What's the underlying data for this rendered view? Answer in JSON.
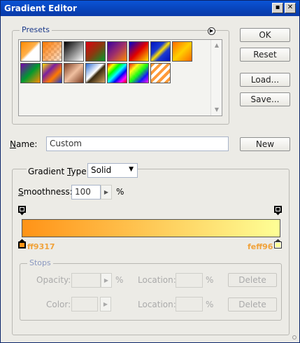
{
  "window": {
    "title": "Gradient Editor",
    "minimize_glyph": "▪",
    "close_glyph": "✕"
  },
  "buttons": {
    "ok": "OK",
    "reset": "Reset",
    "load": "Load...",
    "save": "Save...",
    "new": "New"
  },
  "presets": {
    "label": "Presets",
    "menu_icon": "circle-arrow-icon",
    "swatches": [
      {
        "name": "foreground-to-background"
      },
      {
        "name": "foreground-to-transparent"
      },
      {
        "name": "black-white"
      },
      {
        "name": "red-green"
      },
      {
        "name": "violet-orange"
      },
      {
        "name": "blue-red-yellow"
      },
      {
        "name": "blue-yellow-blue"
      },
      {
        "name": "orange-yellow-orange"
      },
      {
        "name": "violet-green-orange"
      },
      {
        "name": "yellow-violet-orange-blue"
      },
      {
        "name": "copper"
      },
      {
        "name": "chrome"
      },
      {
        "name": "spectrum"
      },
      {
        "name": "transparent-rainbow"
      },
      {
        "name": "transparent-stripes"
      }
    ]
  },
  "name_field": {
    "label_prefix": "",
    "label_underlined": "N",
    "label_rest": "ame:",
    "value": "Custom"
  },
  "gradient_type": {
    "label_prefix": "Gradient ",
    "label_underlined": "T",
    "label_rest": "ype:",
    "value": "Solid"
  },
  "smoothness": {
    "label_prefix": "",
    "label_underlined": "S",
    "label_rest": "moothness:",
    "value": "100",
    "unit": "%"
  },
  "gradient": {
    "start_color": "#ff9317",
    "end_color": "#feff96",
    "start_hex": "ff9317",
    "end_hex": "feff96"
  },
  "stops": {
    "label": "Stops",
    "opacity_label": "Opacity:",
    "opacity_unit": "%",
    "opacity_location_label": "Location:",
    "opacity_location_unit": "%",
    "opacity_delete": "Delete",
    "color_label": "Color:",
    "color_location_label": "Location:",
    "color_location_unit": "%",
    "color_delete": "Delete"
  }
}
